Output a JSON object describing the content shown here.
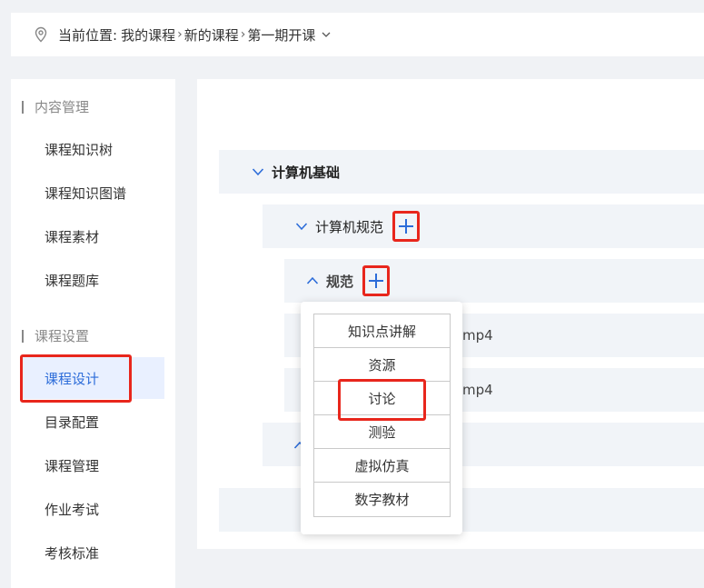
{
  "breadcrumb": {
    "prefix": "当前位置:",
    "items": [
      "我的课程",
      "新的课程",
      "第一期开课"
    ]
  },
  "sidebar": {
    "section1": "内容管理",
    "section1_items": [
      "课程知识树",
      "课程知识图谱",
      "课程素材",
      "课程题库"
    ],
    "section2": "课程设置",
    "section2_items": [
      "课程设计",
      "目录配置",
      "课程管理",
      "作业考试",
      "考核标准"
    ],
    "active": "课程设计"
  },
  "tree": {
    "level1": "计算机基础",
    "level2": "计算机规范",
    "level3": "规范",
    "file1_suffix": "mp4",
    "file2_suffix": "mp4"
  },
  "add_menu": {
    "items": [
      "知识点讲解",
      "资源",
      "讨论",
      "测验",
      "虚拟仿真",
      "数字教材"
    ],
    "highlighted": "讨论"
  },
  "colors": {
    "accent": "#2c6cd9",
    "highlight": "#e8261c",
    "active_bg": "#e9f0ff"
  }
}
